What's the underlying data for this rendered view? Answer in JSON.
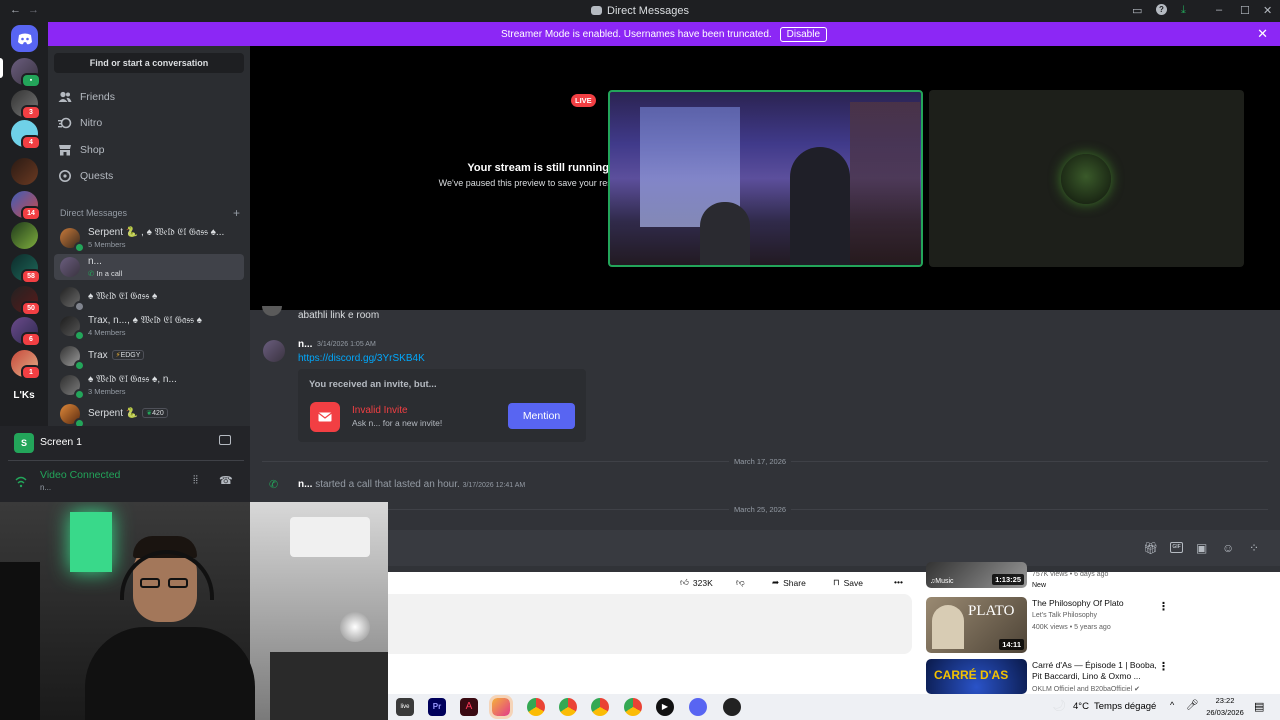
{
  "titlebar": {
    "title": "Direct Messages"
  },
  "banner": {
    "text": "Streamer Mode is enabled. Usernames have been truncated.",
    "disable_label": "Disable"
  },
  "servers": {
    "badges": [
      "3",
      "4",
      "14",
      "58",
      "50",
      "6",
      "1"
    ],
    "text_server_label": "L'Ks"
  },
  "sidebar": {
    "find_placeholder": "Find or start a conversation",
    "nav": [
      {
        "label": "Friends",
        "icon": "friends-icon"
      },
      {
        "label": "Nitro",
        "icon": "nitro-icon"
      },
      {
        "label": "Shop",
        "icon": "shop-icon"
      },
      {
        "label": "Quests",
        "icon": "quests-icon"
      }
    ],
    "dm_header": "Direct Messages",
    "dms": [
      {
        "name": "Serpent 🐍 , ♠ 𝔚𝔢𝔩𝔡 𝔈𝔩 𝔊𝔞𝔰𝔰 ♠...",
        "sub": "5 Members"
      },
      {
        "name": "n...",
        "sub": "In a call"
      },
      {
        "name": "♠ 𝔚𝔢𝔩𝔡 𝔈𝔩 𝔊𝔞𝔰𝔰 ♠",
        "sub": ""
      },
      {
        "name": "Trax, n..., ♠ 𝔚𝔢𝔩𝔡 𝔈𝔩 𝔊𝔞𝔰𝔰 ♠",
        "sub": "4 Members"
      },
      {
        "name": "Trax",
        "sub": "",
        "tag": "EDGY"
      },
      {
        "name": "♠ 𝔚𝔢𝔩𝔡 𝔈𝔩 𝔊𝔞𝔰𝔰 ♠, n...",
        "sub": "3 Members"
      },
      {
        "name": "Serpent 🐍",
        "sub": "",
        "tag": "420"
      }
    ]
  },
  "userpanel": {
    "screen_label": "Screen 1",
    "voice_status": "Video Connected",
    "voice_sub": "n..."
  },
  "stage": {
    "live_badge": "LIVE",
    "paused_title": "Your stream is still running!",
    "paused_sub": "We've paused this preview to save your resources."
  },
  "chat": {
    "prev_message": "abathli link e room",
    "msg_author": "n...",
    "msg_time": "3/14/2026 1:05 AM",
    "msg_link": "https://discord.gg/3YrSKB4K",
    "invite_heading": "You received an invite, but...",
    "invite_title": "Invalid Invite",
    "invite_sub": "Ask n... for a new invite!",
    "mention_label": "Mention",
    "divider1": "March 17, 2026",
    "call_author": "n...",
    "call_text": "started a call that lasted an hour.",
    "call_time": "3/17/2026 12:41 AM",
    "divider2": "March 25, 2026"
  },
  "youtube": {
    "like_count": "323K",
    "share_label": "Share",
    "save_label": "Save",
    "recs": [
      {
        "title": "",
        "meta1": "757K views • 6 days ago",
        "meta2": "New",
        "duration": "1:13:25"
      },
      {
        "title": "The Philosophy Of Plato",
        "meta1": "Let's Talk Philosophy",
        "meta2": "400K views • 5 years ago",
        "duration": "14:11",
        "thumb_text": "PLATO"
      },
      {
        "title": "Carré d'As — Épisode 1 | Booba, Pit Baccardi, Lino & Oxmo ...",
        "meta1": "OKLM Officiel and B20baOfficiel",
        "meta2": "",
        "thumb_text": "CARRÉ D'AS"
      }
    ]
  },
  "taskbar": {
    "weather_temp": "4°C",
    "weather_text": "Temps dégagé",
    "time": "23:22",
    "date": "26/03/2026"
  },
  "colors": {
    "banner": "#8c27f5",
    "blurple": "#5865f2",
    "green": "#23a55a",
    "red": "#f23f43"
  }
}
